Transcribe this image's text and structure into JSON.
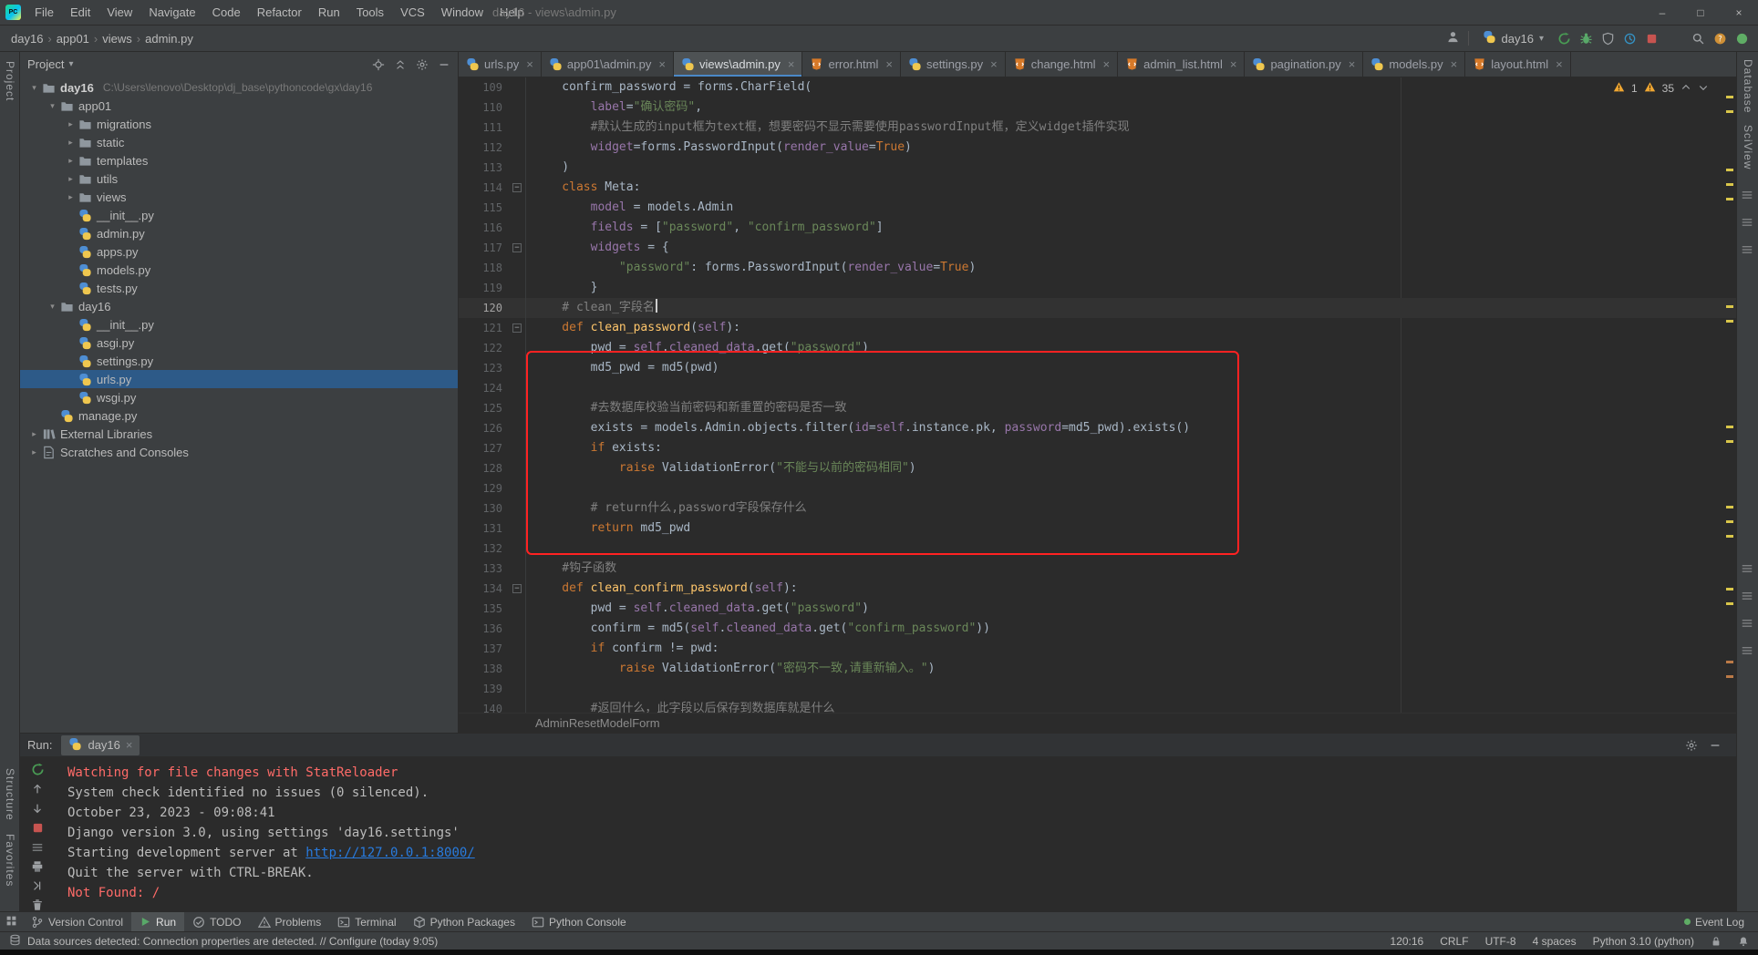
{
  "colors": {
    "editor_bg": "#2b2b2b",
    "panel_bg": "#3c3f41",
    "keyword": "#cc7832",
    "string": "#6a8759",
    "comment": "#808080",
    "field": "#9876aa",
    "function": "#ffc66b",
    "default_text": "#a9b7c6",
    "console_error": "#ff6b68",
    "link": "#287bde",
    "selection": "#2d5a88",
    "active_tab_underline": "#4a88c7",
    "annotation_box": "#ff2222",
    "warning": "#f0a732"
  },
  "title_bar": {
    "menus": [
      "File",
      "Edit",
      "View",
      "Navigate",
      "Code",
      "Refactor",
      "Run",
      "Tools",
      "VCS",
      "Window",
      "Help"
    ],
    "window_title": "day16 - views\\admin.py",
    "window_controls": {
      "minimize": "–",
      "maximize": "□",
      "close": "×"
    }
  },
  "nav_bar": {
    "breadcrumbs": [
      "day16",
      "app01",
      "views",
      "admin.py"
    ],
    "run_config": "day16"
  },
  "left_stripe": {
    "top": [
      "Project"
    ],
    "bottom": [
      "Structure",
      "Favorites"
    ]
  },
  "right_stripe": {
    "labels": [
      "Database",
      "SciView"
    ]
  },
  "project_panel": {
    "title": "Project",
    "tree": [
      {
        "indent": 0,
        "chevron": "open",
        "icon": "folder",
        "label": "day16",
        "path": "C:\\Users\\lenovo\\Desktop\\dj_base\\pythoncode\\gx\\day16",
        "bold": true
      },
      {
        "indent": 1,
        "chevron": "open",
        "icon": "folder",
        "label": "app01"
      },
      {
        "indent": 2,
        "chevron": "closed",
        "icon": "folder",
        "label": "migrations"
      },
      {
        "indent": 2,
        "chevron": "closed",
        "icon": "folder",
        "label": "static"
      },
      {
        "indent": 2,
        "chevron": "closed",
        "icon": "folder",
        "label": "templates"
      },
      {
        "indent": 2,
        "chevron": "closed",
        "icon": "folder",
        "label": "utils"
      },
      {
        "indent": 2,
        "chevron": "closed",
        "icon": "folder",
        "label": "views"
      },
      {
        "indent": 2,
        "icon": "python",
        "label": "__init__.py"
      },
      {
        "indent": 2,
        "icon": "python",
        "label": "admin.py"
      },
      {
        "indent": 2,
        "icon": "python",
        "label": "apps.py"
      },
      {
        "indent": 2,
        "icon": "python",
        "label": "models.py"
      },
      {
        "indent": 2,
        "icon": "python",
        "label": "tests.py"
      },
      {
        "indent": 1,
        "chevron": "open",
        "icon": "folder",
        "label": "day16"
      },
      {
        "indent": 2,
        "icon": "python",
        "label": "__init__.py"
      },
      {
        "indent": 2,
        "icon": "python",
        "label": "asgi.py"
      },
      {
        "indent": 2,
        "icon": "python",
        "label": "settings.py"
      },
      {
        "indent": 2,
        "icon": "python",
        "label": "urls.py",
        "selected": true
      },
      {
        "indent": 2,
        "icon": "python",
        "label": "wsgi.py"
      },
      {
        "indent": 1,
        "icon": "python",
        "label": "manage.py"
      },
      {
        "indent": 0,
        "chevron": "closed",
        "icon": "libraries",
        "label": "External Libraries"
      },
      {
        "indent": 0,
        "chevron": "closed",
        "icon": "scratches",
        "label": "Scratches and Consoles"
      }
    ]
  },
  "editor": {
    "tabs": [
      {
        "label": "urls.py",
        "icon": "python"
      },
      {
        "label": "app01\\admin.py",
        "icon": "python"
      },
      {
        "label": "views\\admin.py",
        "icon": "python",
        "active": true
      },
      {
        "label": "error.html",
        "icon": "html"
      },
      {
        "label": "settings.py",
        "icon": "python"
      },
      {
        "label": "change.html",
        "icon": "html"
      },
      {
        "label": "admin_list.html",
        "icon": "html"
      },
      {
        "label": "pagination.py",
        "icon": "python"
      },
      {
        "label": "models.py",
        "icon": "python"
      },
      {
        "label": "layout.html",
        "icon": "html"
      }
    ],
    "inspections": {
      "errors": "1",
      "warnings": "35"
    },
    "breadcrumb_bottom": "AdminResetModelForm",
    "lines": [
      {
        "n": 109,
        "segs": [
          [
            "d",
            "    confirm_password = forms.CharField("
          ]
        ]
      },
      {
        "n": 110,
        "segs": [
          [
            "d",
            "        "
          ],
          [
            "p",
            "label"
          ],
          [
            "d",
            "="
          ],
          [
            "s",
            "\"确认密码\""
          ],
          [
            "d",
            ","
          ]
        ]
      },
      {
        "n": 111,
        "segs": [
          [
            "c u",
            "        #默认生成的input框为text框，想要密码不显示需要使用passwordInput框，定义widget插件实现"
          ]
        ]
      },
      {
        "n": 112,
        "segs": [
          [
            "d",
            "        "
          ],
          [
            "p",
            "widget"
          ],
          [
            "d",
            "=forms.PasswordInput("
          ],
          [
            "p",
            "render_value"
          ],
          [
            "d",
            "="
          ],
          [
            "k",
            "True"
          ],
          [
            "d",
            ")"
          ]
        ]
      },
      {
        "n": 113,
        "segs": [
          [
            "d",
            "    )"
          ]
        ]
      },
      {
        "n": 114,
        "fold": true,
        "segs": [
          [
            "k",
            "    class "
          ],
          [
            "d u",
            "Meta"
          ],
          [
            "d",
            ":"
          ]
        ]
      },
      {
        "n": 115,
        "segs": [
          [
            "d",
            "        "
          ],
          [
            "p",
            "model"
          ],
          [
            "d",
            " = models.Admin"
          ]
        ]
      },
      {
        "n": 116,
        "segs": [
          [
            "d",
            "        "
          ],
          [
            "p",
            "fields"
          ],
          [
            "d",
            " = ["
          ],
          [
            "s",
            "\"password\""
          ],
          [
            "d",
            ", "
          ],
          [
            "s",
            "\"confirm_password\""
          ],
          [
            "d",
            "]"
          ]
        ]
      },
      {
        "n": 117,
        "fold": true,
        "segs": [
          [
            "d",
            "        "
          ],
          [
            "p",
            "widgets"
          ],
          [
            "d",
            " = {"
          ]
        ]
      },
      {
        "n": 118,
        "segs": [
          [
            "d",
            "            "
          ],
          [
            "s",
            "\"password\""
          ],
          [
            "d",
            ": forms.PasswordInput("
          ],
          [
            "p",
            "render_value"
          ],
          [
            "d",
            "="
          ],
          [
            "k",
            "True"
          ],
          [
            "d",
            ")"
          ]
        ]
      },
      {
        "n": 119,
        "segs": [
          [
            "d",
            "        }"
          ]
        ]
      },
      {
        "n": 120,
        "active": true,
        "caret": true,
        "segs": [
          [
            "c",
            "    # clean_字段名"
          ]
        ]
      },
      {
        "n": 121,
        "fold": true,
        "segs": [
          [
            "k",
            "    def "
          ],
          [
            "f u",
            "clean_password"
          ],
          [
            "d",
            "("
          ],
          [
            "p",
            "self"
          ],
          [
            "d",
            "):"
          ]
        ]
      },
      {
        "n": 122,
        "segs": [
          [
            "d",
            "        pwd = "
          ],
          [
            "p",
            "self"
          ],
          [
            "d",
            "."
          ],
          [
            "p",
            "cleaned_data"
          ],
          [
            "d",
            ".get("
          ],
          [
            "s u",
            "\"password\""
          ],
          [
            "d",
            ")"
          ]
        ]
      },
      {
        "n": 123,
        "segs": [
          [
            "d",
            "        md5_pwd = md5(pwd)"
          ]
        ]
      },
      {
        "n": 124,
        "segs": []
      },
      {
        "n": 125,
        "segs": [
          [
            "c u",
            "        #去数据库校验当前密码和新重置的密码是否一致"
          ]
        ]
      },
      {
        "n": 126,
        "segs": [
          [
            "d",
            "        exists = models.Admin.objects.filter("
          ],
          [
            "p",
            "id"
          ],
          [
            "d",
            "="
          ],
          [
            "p",
            "self"
          ],
          [
            "d",
            ".instance.pk, "
          ],
          [
            "p",
            "password"
          ],
          [
            "d",
            "=md5_pwd).exists()"
          ]
        ]
      },
      {
        "n": 127,
        "segs": [
          [
            "k",
            "        if "
          ],
          [
            "d",
            "exists:"
          ]
        ]
      },
      {
        "n": 128,
        "segs": [
          [
            "d",
            "            "
          ],
          [
            "k",
            "raise "
          ],
          [
            "d",
            "ValidationError("
          ],
          [
            "s",
            "\"不能与以前的密码相同\""
          ],
          [
            "d",
            ")"
          ]
        ]
      },
      {
        "n": 129,
        "segs": []
      },
      {
        "n": 130,
        "segs": [
          [
            "c",
            "        # return什么,password字段保存什么"
          ]
        ]
      },
      {
        "n": 131,
        "segs": [
          [
            "d",
            "        "
          ],
          [
            "k",
            "return "
          ],
          [
            "d",
            "md5_pwd"
          ]
        ]
      },
      {
        "n": 132,
        "segs": []
      },
      {
        "n": 133,
        "segs": [
          [
            "c u",
            "    #钩子函数"
          ]
        ]
      },
      {
        "n": 134,
        "fold": true,
        "segs": [
          [
            "k",
            "    def "
          ],
          [
            "f u",
            "clean_confirm_password"
          ],
          [
            "d",
            "("
          ],
          [
            "p",
            "self"
          ],
          [
            "d",
            "):"
          ]
        ]
      },
      {
        "n": 135,
        "segs": [
          [
            "d",
            "        pwd = "
          ],
          [
            "p",
            "self"
          ],
          [
            "d",
            "."
          ],
          [
            "p",
            "cleaned_data"
          ],
          [
            "d",
            ".get("
          ],
          [
            "s",
            "\"password\""
          ],
          [
            "d",
            ")"
          ]
        ]
      },
      {
        "n": 136,
        "segs": [
          [
            "d",
            "        confirm = md5("
          ],
          [
            "p",
            "self"
          ],
          [
            "d",
            "."
          ],
          [
            "p",
            "cleaned_data"
          ],
          [
            "d",
            ".get("
          ],
          [
            "s",
            "\"confirm_password\""
          ],
          [
            "d",
            "))"
          ]
        ]
      },
      {
        "n": 137,
        "segs": [
          [
            "k",
            "        if "
          ],
          [
            "d",
            "confirm != pwd:"
          ]
        ]
      },
      {
        "n": 138,
        "segs": [
          [
            "d",
            "            "
          ],
          [
            "k",
            "raise "
          ],
          [
            "d",
            "ValidationError("
          ],
          [
            "s",
            "\"密码不一致,请重新输入。\""
          ],
          [
            "d",
            ")"
          ]
        ]
      },
      {
        "n": 139,
        "segs": []
      },
      {
        "n": 140,
        "segs": [
          [
            "c u",
            "        #返回什么，此字段以后保存到数据库就是什么"
          ]
        ]
      }
    ]
  },
  "run_panel": {
    "label": "Run:",
    "tab": "day16",
    "console": [
      {
        "style": "error",
        "text": "Watching for file changes with StatReloader"
      },
      {
        "style": "plain",
        "text": "System check identified no issues (0 silenced)."
      },
      {
        "style": "plain",
        "text": "October 23, 2023 - 09:08:41"
      },
      {
        "style": "plain",
        "text": "Django version 3.0, using settings 'day16.settings'"
      },
      {
        "style": "plain",
        "text": "Starting development server at ",
        "link": "http://127.0.0.1:8000/"
      },
      {
        "style": "plain",
        "text": "Quit the server with CTRL-BREAK."
      },
      {
        "style": "error",
        "text": "Not Found: /"
      }
    ]
  },
  "bottom_bar": {
    "left": [
      {
        "icon": "version-control",
        "label": "Version Control"
      },
      {
        "icon": "run-play",
        "label": "Run",
        "active": true
      },
      {
        "icon": "todo",
        "label": "TODO"
      },
      {
        "icon": "problems",
        "label": "Problems"
      },
      {
        "icon": "terminal",
        "label": "Terminal"
      },
      {
        "icon": "packages",
        "label": "Python Packages"
      },
      {
        "icon": "python-console",
        "label": "Python Console"
      }
    ],
    "right": [
      {
        "icon": "event-log",
        "label": "Event Log"
      }
    ]
  },
  "status_bar": {
    "message": "Data sources detected: Connection properties are detected. // Configure (today 9:05)",
    "items": [
      "120:16",
      "CRLF",
      "UTF-8",
      "4 spaces",
      "Python 3.10 (python)"
    ]
  }
}
